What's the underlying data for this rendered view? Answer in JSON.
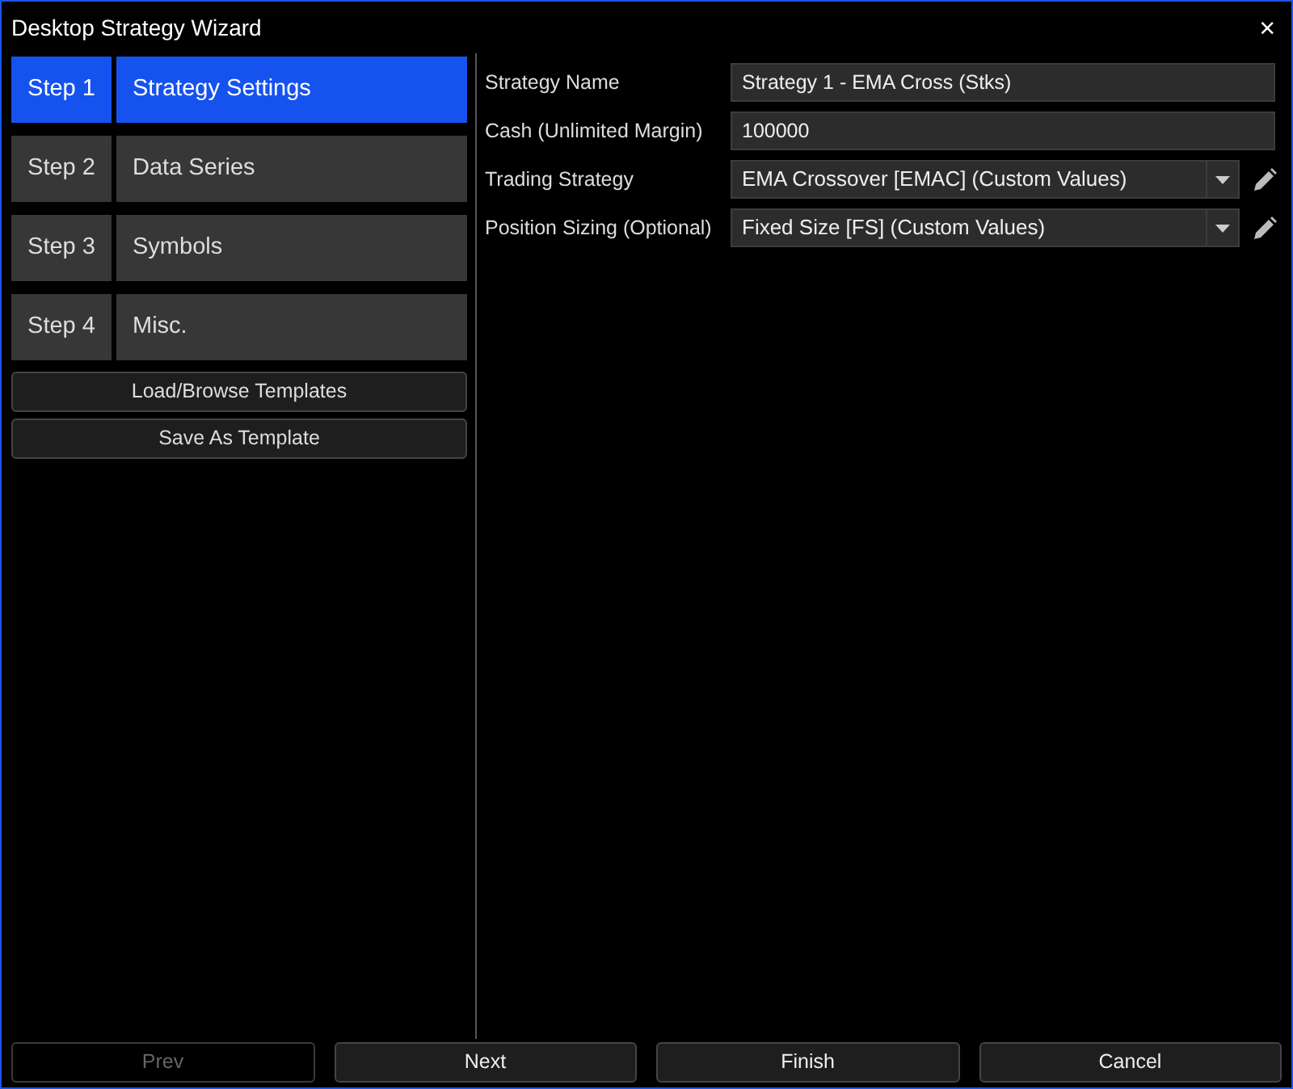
{
  "window": {
    "title": "Desktop Strategy Wizard",
    "close": "×"
  },
  "steps": [
    {
      "number": "Step 1",
      "label": "Strategy Settings",
      "selected": true
    },
    {
      "number": "Step 2",
      "label": "Data Series",
      "selected": false
    },
    {
      "number": "Step 3",
      "label": "Symbols",
      "selected": false
    },
    {
      "number": "Step 4",
      "label": "Misc.",
      "selected": false
    }
  ],
  "template_buttons": [
    "Load/Browse Templates",
    "Save As Template"
  ],
  "fields": [
    {
      "label": "Strategy Name",
      "kind": "text",
      "value": "Strategy 1 - EMA Cross (Stks)"
    },
    {
      "label": "Cash (Unlimited Margin)",
      "kind": "text",
      "value": "100000"
    },
    {
      "label": "Trading Strategy",
      "kind": "select",
      "value": "EMA Crossover [EMAC] (Custom Values)"
    },
    {
      "label": "Position Sizing (Optional)",
      "kind": "select",
      "value": "Fixed Size [FS] (Custom Values)"
    }
  ],
  "footer_buttons": [
    {
      "label": "Prev",
      "disabled": true
    },
    {
      "label": "Next",
      "disabled": false
    },
    {
      "label": "Finish",
      "disabled": false
    },
    {
      "label": "Cancel",
      "disabled": false
    }
  ]
}
